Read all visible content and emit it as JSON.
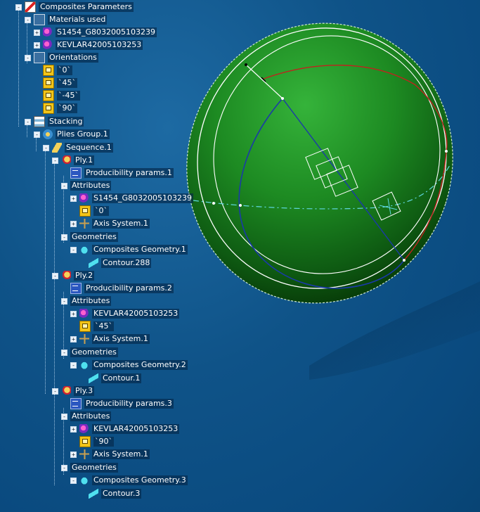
{
  "colors": {
    "viewport_background": "#0b4c82",
    "sphere_green": "#1e8f24",
    "sphere_dark": "#0a3a0a",
    "curve_white": "#ffffff",
    "curve_blue": "#1a3aa8",
    "curve_red": "#b0201c",
    "curve_cyan": "#5fd8e0"
  },
  "tree": {
    "nodes": [
      {
        "label": "Composites Parameters",
        "icon": "composites-icon",
        "expander": "-",
        "name": "node-composites-parameters"
      },
      {
        "label": "Materials used",
        "icon": "folder-icon",
        "expander": "-",
        "name": "node-materials-used"
      },
      {
        "label": "S1454_G8032005103239",
        "icon": "material-icon",
        "expander": "+",
        "name": "node-material-s1454"
      },
      {
        "label": "KEVLAR42005103253",
        "icon": "material-icon",
        "expander": "+",
        "name": "node-material-kevlar"
      },
      {
        "label": "Orientations",
        "icon": "folder-icon",
        "expander": "-",
        "name": "node-orientations"
      },
      {
        "label": "`0`",
        "icon": "orientation-icon",
        "expander": "",
        "name": "node-orientation-0"
      },
      {
        "label": "`45`",
        "icon": "orientation-icon",
        "expander": "",
        "name": "node-orientation-45"
      },
      {
        "label": "`-45`",
        "icon": "orientation-icon",
        "expander": "",
        "name": "node-orientation-minus45"
      },
      {
        "label": "`90`",
        "icon": "orientation-icon",
        "expander": "",
        "name": "node-orientation-90"
      },
      {
        "label": "Stacking",
        "icon": "stacking-icon",
        "expander": "-",
        "name": "node-stacking"
      },
      {
        "label": "Plies Group.1",
        "icon": "plies-group-icon",
        "expander": "-",
        "name": "node-plies-group"
      },
      {
        "label": "Sequence.1",
        "icon": "sequence-icon",
        "expander": "-",
        "name": "node-sequence"
      },
      {
        "label": "Ply.1",
        "icon": "ply-icon",
        "expander": "-",
        "name": "node-ply-1"
      },
      {
        "label": "Producibility params.1",
        "icon": "producibility-icon",
        "expander": "",
        "name": "node-producibility-1"
      },
      {
        "label": "Attributes",
        "icon": "",
        "expander": "-",
        "name": "node-attributes-1"
      },
      {
        "label": "S1454_G8032005103239",
        "icon": "material-icon",
        "expander": "+",
        "name": "node-ply1-material"
      },
      {
        "label": "`0`",
        "icon": "orientation-icon",
        "expander": "",
        "name": "node-ply1-orientation"
      },
      {
        "label": "Axis System.1",
        "icon": "axis-system-icon",
        "expander": "+",
        "name": "node-ply1-axis"
      },
      {
        "label": "Geometries",
        "icon": "",
        "expander": "-",
        "name": "node-geometries-1"
      },
      {
        "label": "Composites Geometry.1",
        "icon": "geometry-icon",
        "expander": "-",
        "name": "node-geometry-1"
      },
      {
        "label": "Contour.288",
        "icon": "contour-icon",
        "expander": "",
        "name": "node-contour-288"
      },
      {
        "label": "Ply.2",
        "icon": "ply-icon",
        "expander": "-",
        "name": "node-ply-2"
      },
      {
        "label": "Producibility params.2",
        "icon": "producibility-icon",
        "expander": "",
        "name": "node-producibility-2"
      },
      {
        "label": "Attributes",
        "icon": "",
        "expander": "-",
        "name": "node-attributes-2"
      },
      {
        "label": "KEVLAR42005103253",
        "icon": "material-icon",
        "expander": "+",
        "name": "node-ply2-material"
      },
      {
        "label": "`45`",
        "icon": "orientation-icon",
        "expander": "",
        "name": "node-ply2-orientation"
      },
      {
        "label": "Axis System.1",
        "icon": "axis-system-icon",
        "expander": "+",
        "name": "node-ply2-axis"
      },
      {
        "label": "Geometries",
        "icon": "",
        "expander": "-",
        "name": "node-geometries-2"
      },
      {
        "label": "Composites Geometry.2",
        "icon": "geometry-icon",
        "expander": "-",
        "name": "node-geometry-2"
      },
      {
        "label": "Contour.1",
        "icon": "contour-icon",
        "expander": "",
        "name": "node-contour-1"
      },
      {
        "label": "Ply.3",
        "icon": "ply-icon",
        "expander": "-",
        "name": "node-ply-3"
      },
      {
        "label": "Producibility params.3",
        "icon": "producibility-icon",
        "expander": "",
        "name": "node-producibility-3"
      },
      {
        "label": "Attributes",
        "icon": "",
        "expander": "-",
        "name": "node-attributes-3"
      },
      {
        "label": "KEVLAR42005103253",
        "icon": "material-icon",
        "expander": "+",
        "name": "node-ply3-material"
      },
      {
        "label": "`90`",
        "icon": "orientation-icon",
        "expander": "",
        "name": "node-ply3-orientation"
      },
      {
        "label": "Axis System.1",
        "icon": "axis-system-icon",
        "expander": "+",
        "name": "node-ply3-axis"
      },
      {
        "label": "Geometries",
        "icon": "",
        "expander": "-",
        "name": "node-geometries-3"
      },
      {
        "label": "Composites Geometry.3",
        "icon": "geometry-icon",
        "expander": "-",
        "name": "node-geometry-3"
      },
      {
        "label": "Contour.3",
        "icon": "contour-icon",
        "expander": "",
        "name": "node-contour-3"
      }
    ]
  }
}
